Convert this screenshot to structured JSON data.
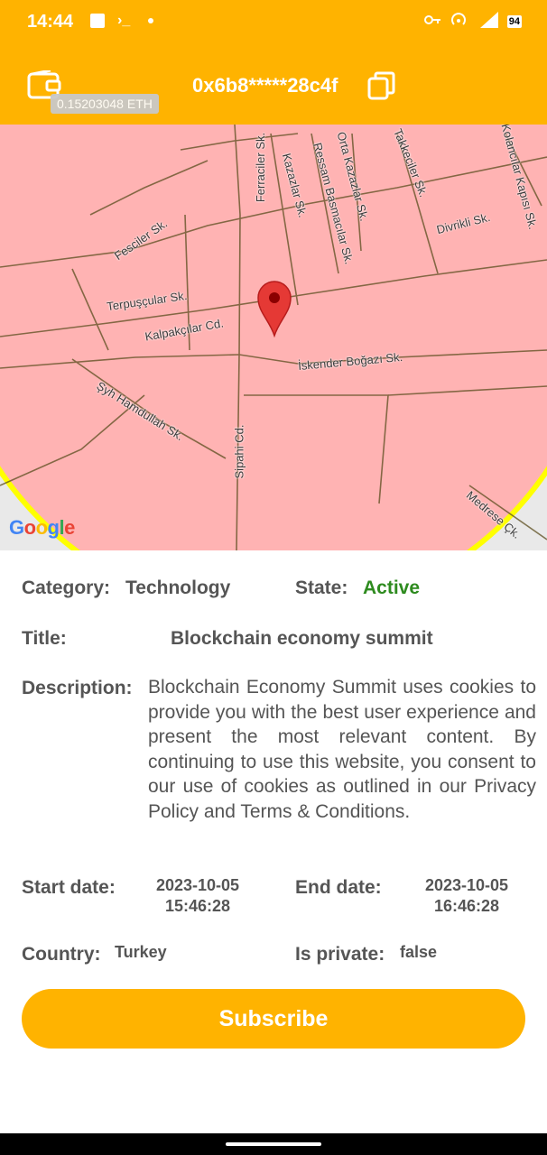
{
  "status_bar": {
    "time": "14:44",
    "battery": "94"
  },
  "header": {
    "balance": "0.15203048 ETH",
    "address": "0x6b8*****28c4f"
  },
  "map": {
    "streets": [
      "Ferraciler Sk.",
      "Kazazlar Sk.",
      "Ressam Basmacılar Sk.",
      "Orta Kazazlar Sk.",
      "Takkeciler Sk.",
      "Kolancılar Kapısı Sk.",
      "Fesciler Sk.",
      "Divrikli Sk.",
      "Terpuşçular Sk.",
      "Kalpakçılar Cd.",
      "İskender Boğazı Sk.",
      "Şyh Hamdullah Sk.",
      "Sipahi Cd.",
      "Medrese Çk."
    ],
    "logo": "Google"
  },
  "event": {
    "category_label": "Category:",
    "category": "Technology",
    "state_label": "State:",
    "state": "Active",
    "title_label": "Title:",
    "title": "Blockchain economy summit",
    "description_label": "Description:",
    "description": "Blockchain Economy Summit uses cookies to provide you with the best user experience and present the most relevant content. By continuing to use this website, you consent to our use of cookies as outlined in our Privacy Policy and Terms & Conditions.",
    "start_label": "Start date:",
    "start_date": "2023-10-05",
    "start_time": "15:46:28",
    "end_label": "End date:",
    "end_date": "2023-10-05",
    "end_time": "16:46:28",
    "country_label": "Country:",
    "country": "Turkey",
    "private_label": "Is private:",
    "private": "false"
  },
  "actions": {
    "subscribe": "Subscribe"
  },
  "colors": {
    "accent": "#ffb300",
    "active": "#2e8b1f",
    "zone_fill": "#ffb3b3",
    "zone_border": "#ffff00"
  }
}
